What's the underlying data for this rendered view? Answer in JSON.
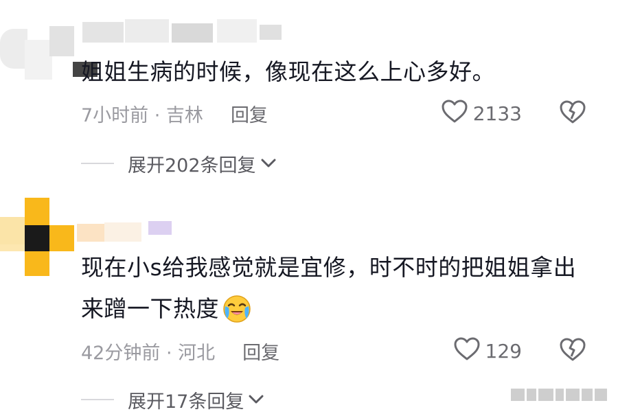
{
  "comments": [
    {
      "text": "姐姐生病的时候，像现在这么上心多好。",
      "time_location": "7小时前 · 吉林",
      "reply_label": "回复",
      "likes": "2133",
      "expand_label": "展开202条回复"
    },
    {
      "text_line1": "现在小s给我感觉就是宜修，时不时的把姐姐拿出",
      "text_line2": "来蹭一下热度",
      "emoji": "laughing-crying-emoji",
      "time_location": "42分钟前 · 河北",
      "reply_label": "回复",
      "likes": "129",
      "expand_label": "展开17条回复"
    }
  ],
  "icons": {
    "like": "heart-outline-icon",
    "dislike": "broken-heart-icon",
    "expand": "chevron-down-icon"
  },
  "colors": {
    "text": "#161823",
    "meta": "#9a9aa0",
    "avatar_yellow": "#f9b81b",
    "avatar_dark": "#1a1a1a"
  }
}
